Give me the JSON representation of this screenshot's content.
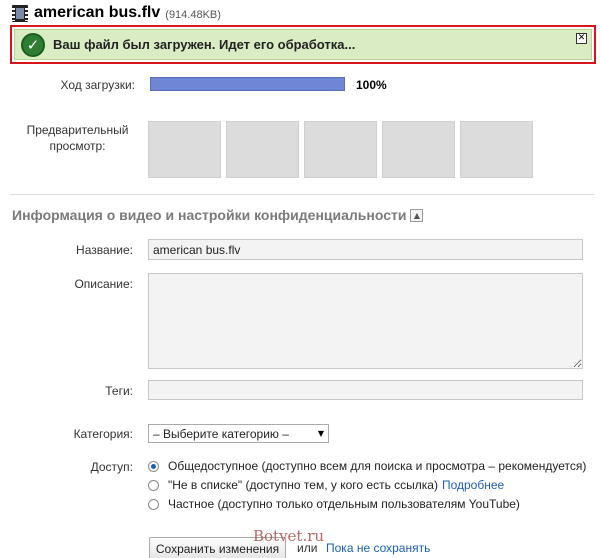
{
  "file": {
    "name": "american bus.flv",
    "size": "(914.48KB)"
  },
  "notice": {
    "text": "Ваш файл был загружен. Идет его обработка...",
    "icon": "check-icon",
    "close_symbol": "✕"
  },
  "upload": {
    "progress_label": "Ход загрузки:",
    "progress_percent": 100,
    "progress_text": "100%"
  },
  "preview": {
    "label": "Предварительный просмотр:",
    "thumbnail_count": 5
  },
  "section": {
    "title": "Информация о видео и настройки конфиденциальности"
  },
  "form": {
    "title_label": "Название:",
    "title_value": "american bus.flv",
    "description_label": "Описание:",
    "description_value": "",
    "tags_label": "Теги:",
    "tags_value": "",
    "category_label": "Категория:",
    "category_value": "– Выберите категорию –",
    "access_label": "Доступ:",
    "access_options": [
      {
        "label": "Общедоступное (доступно всем для поиска и просмотра – рекомендуется)",
        "selected": true
      },
      {
        "label": "\"Не в списке\" (доступно тем, у кого есть ссылка)",
        "selected": false,
        "link": "Подробнее"
      },
      {
        "label": "Частное (доступно только отдельным пользователям YouTube)",
        "selected": false
      }
    ]
  },
  "actions": {
    "save_label": "Сохранить изменения",
    "or_text": "или",
    "cancel_label": "Пока не сохранять"
  },
  "watermark": "Botvet.ru",
  "colors": {
    "notice_border": "#d8141c",
    "notice_bg": "#d9ecc4",
    "progress_fill": "#6f86d6",
    "link": "#1a5fb4"
  }
}
